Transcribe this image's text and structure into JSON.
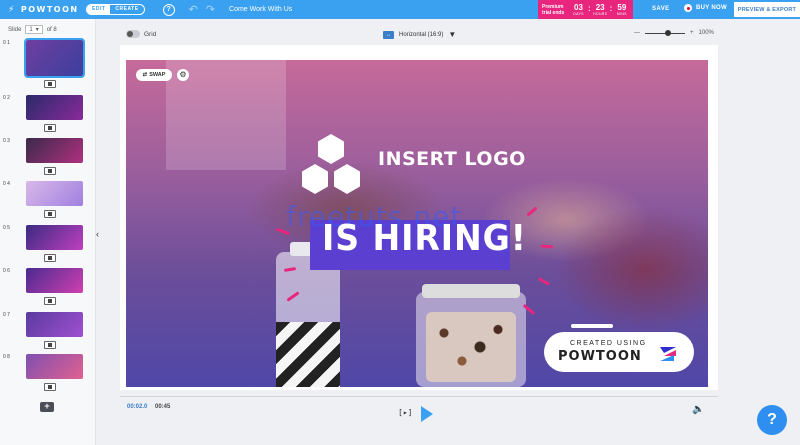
{
  "topbar": {
    "logo": "POWTOON",
    "mode_edit": "EDIT",
    "mode_create": "CREATE",
    "help": "?",
    "doc_title": "Come Work With Us",
    "trial_label": "Premium trial ends",
    "countdown": [
      {
        "value": "03",
        "unit": "DAYS"
      },
      {
        "value": "23",
        "unit": "HOURS"
      },
      {
        "value": "59",
        "unit": "MINS"
      }
    ],
    "save": "SAVE",
    "buy": "BUY NOW",
    "export": "PREVIEW & EXPORT"
  },
  "sidebar": {
    "slide_label": "Slide",
    "current": "1",
    "of": "of 8",
    "slides": [
      {
        "num": "0 1",
        "colors": [
          "#6e3fa0",
          "#3c3f9e"
        ]
      },
      {
        "num": "0 2",
        "colors": [
          "#2a2a6a",
          "#8a2a9a"
        ]
      },
      {
        "num": "0 3",
        "colors": [
          "#3a2a4a",
          "#b03080"
        ]
      },
      {
        "num": "0 4",
        "colors": [
          "#d8b8e8",
          "#a080e0"
        ]
      },
      {
        "num": "0 5",
        "colors": [
          "#3a2a80",
          "#c040c0"
        ]
      },
      {
        "num": "0 6",
        "colors": [
          "#4a2a90",
          "#d040b0"
        ]
      },
      {
        "num": "0 7",
        "colors": [
          "#5a3aa0",
          "#a050d0"
        ]
      },
      {
        "num": "0 8",
        "colors": [
          "#8050b0",
          "#e06090"
        ]
      }
    ]
  },
  "toolbar": {
    "grid": "Grid",
    "orientation": "Horizontal (16:9)",
    "zoom_minus": "—",
    "zoom_plus": "+",
    "zoom": "100%"
  },
  "canvas": {
    "swap": "SWAP",
    "insert_logo": "INSERT LOGO",
    "headline": "IS HIRING!",
    "watermark": "freetuts.net",
    "credit_top": "CREATED USING",
    "credit_brand": "POWTOON"
  },
  "playbar": {
    "current_time": "00:02.0",
    "total_time": "00:45"
  },
  "help_fab": "?"
}
